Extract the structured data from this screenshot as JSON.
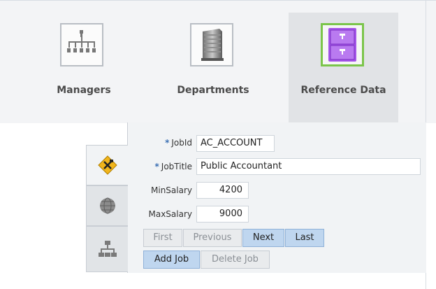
{
  "nav": {
    "items": [
      {
        "label": "Managers",
        "icon": "org-chart-icon",
        "active": false
      },
      {
        "label": "Departments",
        "icon": "building-icon",
        "active": false
      },
      {
        "label": "Reference Data",
        "icon": "filing-cabinet-icon",
        "active": true
      }
    ]
  },
  "side_tabs": [
    {
      "icon": "tools-icon",
      "active": true
    },
    {
      "icon": "globe-icon",
      "active": false
    },
    {
      "icon": "network-icon",
      "active": false
    }
  ],
  "form": {
    "required_marker": "*",
    "job_id": {
      "label": "JobId",
      "value": "AC_ACCOUNT"
    },
    "job_title": {
      "label": "JobTitle",
      "value": "Public Accountant"
    },
    "min_salary": {
      "label": "MinSalary",
      "value": "4200"
    },
    "max_salary": {
      "label": "MaxSalary",
      "value": "9000"
    }
  },
  "buttons": {
    "first": "First",
    "previous": "Previous",
    "next": "Next",
    "last": "Last",
    "add_job": "Add Job",
    "delete_job": "Delete Job"
  },
  "colors": {
    "active_border": "#7bc54b",
    "accent_purple": "#a455e8",
    "enabled_button": "#bfd6ef"
  }
}
